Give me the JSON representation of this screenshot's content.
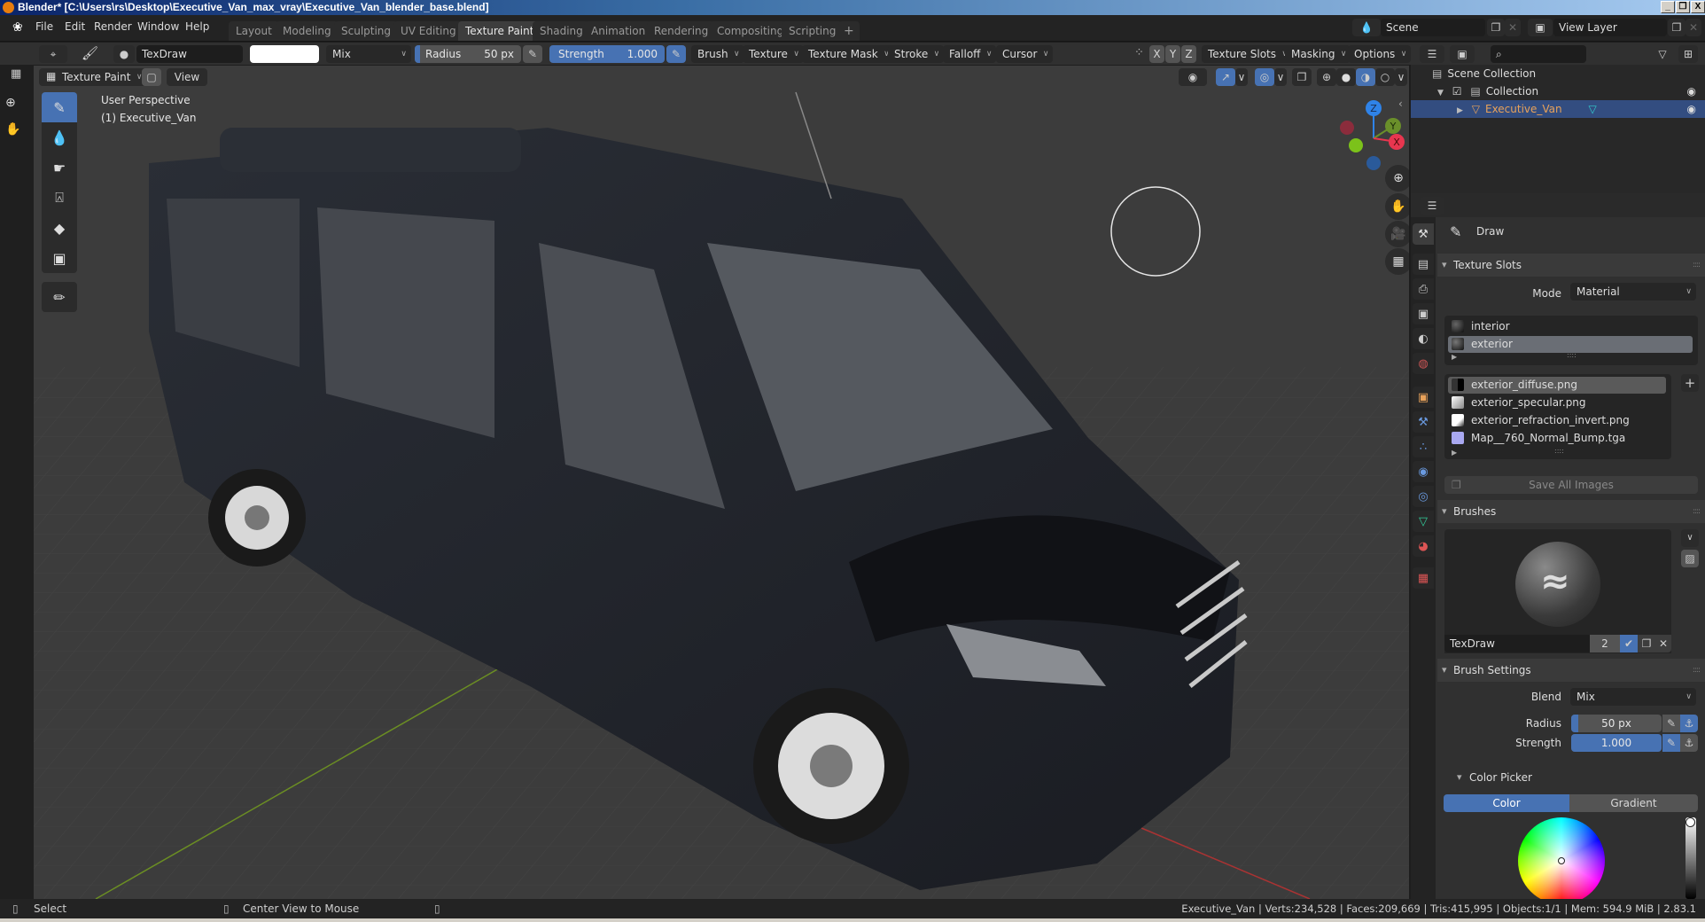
{
  "window": {
    "title": "Blender* [C:\\Users\\rs\\Desktop\\Executive_Van_max_vray\\Executive_Van_blender_base.blend]",
    "controls": [
      "_",
      "❐",
      "X"
    ]
  },
  "menu": {
    "items": [
      "File",
      "Edit",
      "Render",
      "Window",
      "Help"
    ],
    "workspaces": [
      "Layout",
      "Modeling",
      "Sculpting",
      "UV Editing",
      "Texture Paint",
      "Shading",
      "Animation",
      "Rendering",
      "Compositing",
      "Scripting"
    ],
    "active_workspace": "Texture Paint",
    "add_workspace": "+",
    "scene": "Scene",
    "view_layer": "View Layer"
  },
  "toolheader": {
    "brush_name": "TexDraw",
    "color_hex": "#ffffff",
    "blend": "Mix",
    "radius_label": "Radius",
    "radius_value": "50 px",
    "strength_label": "Strength",
    "strength_value": "1.000",
    "menus": [
      "Brush",
      "Texture",
      "Texture Mask",
      "Stroke",
      "Falloff",
      "Cursor"
    ],
    "axes": [
      "X",
      "Y",
      "Z"
    ],
    "right_menus": [
      "Texture Slots",
      "Masking",
      "Options"
    ]
  },
  "viewheader": {
    "mode": "Texture Paint",
    "view": "View"
  },
  "viewport": {
    "perspective": "User Perspective",
    "object": "(1) Executive_Van",
    "gizmo_axes": [
      "Z",
      "Y",
      "X"
    ],
    "nav_icons": [
      "zoom-icon",
      "hand-icon",
      "camera-icon",
      "grid-icon"
    ]
  },
  "outliner": {
    "search_placeholder": "",
    "rows": [
      {
        "label": "Scene Collection",
        "type": "scene-collection"
      },
      {
        "label": "Collection",
        "type": "collection"
      },
      {
        "label": "Executive_Van",
        "type": "mesh-object",
        "selected": true
      }
    ]
  },
  "properties": {
    "tool_name": "Draw",
    "texture_slots": {
      "title": "Texture Slots",
      "mode_label": "Mode",
      "mode_value": "Material",
      "materials": [
        "interior",
        "exterior"
      ],
      "selected_material": "exterior",
      "images": [
        "exterior_diffuse.png",
        "exterior_specular.png",
        "exterior_refraction_invert.png",
        "Map__760_Normal_Bump.tga"
      ],
      "selected_image": "exterior_diffuse.png",
      "save_all": "Save All Images"
    },
    "brushes": {
      "title": "Brushes",
      "brush_name": "TexDraw",
      "users": "2"
    },
    "brush_settings": {
      "title": "Brush Settings",
      "blend_label": "Blend",
      "blend_value": "Mix",
      "radius_label": "Radius",
      "radius_value": "50 px",
      "strength_label": "Strength",
      "strength_value": "1.000",
      "strength_fraction": 1.0
    },
    "color_picker": {
      "title": "Color Picker",
      "tabs": [
        "Color",
        "Gradient"
      ],
      "active_tab": "Color",
      "value": 1.0
    }
  },
  "statusbar": {
    "left": [
      "Select",
      "Center View to Mouse"
    ],
    "stats": "Executive_Van | Verts:234,528 | Faces:209,669 | Tris:415,995 | Objects:1/1 | Mem: 594.9 MiB | 2.83.1"
  },
  "colors": {
    "accent": "#4772b3",
    "selection": "#334d80",
    "object_orange": "#e8a25a"
  }
}
